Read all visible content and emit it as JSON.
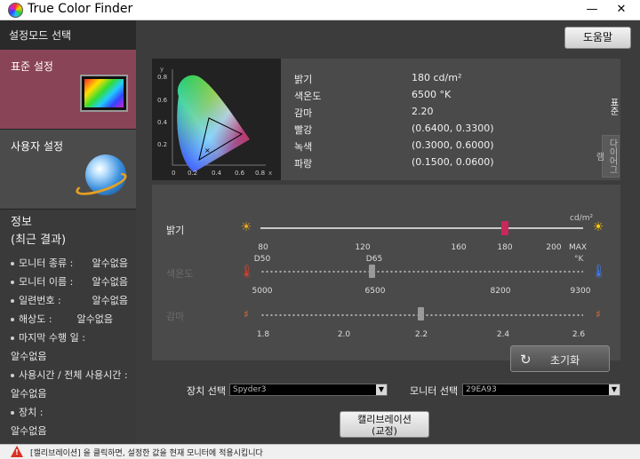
{
  "window": {
    "title": "True Color Finder",
    "minimize": "—",
    "close": "✕"
  },
  "sidebar": {
    "header": "설정모드 선택",
    "modes": [
      {
        "label": "표준 설정"
      },
      {
        "label": "사용자 설정"
      }
    ],
    "info_title_line1": "정보",
    "info_title_line2": "(최근 결과)",
    "info_items": [
      {
        "label": "모니터 종류 :",
        "value": "알수없음"
      },
      {
        "label": "모니터 이름 :",
        "value": "알수없음"
      },
      {
        "label": "일련번호 :",
        "value": "알수없음"
      },
      {
        "label": "해상도 :",
        "value": "알수없음"
      },
      {
        "label": "마지막 수행 일 :",
        "value": "알수없음"
      },
      {
        "label": "사용시간 / 전체 사용시간 :",
        "value": "알수없음"
      },
      {
        "label": "장치 :",
        "value": "알수없음"
      }
    ]
  },
  "help_button": "도움말",
  "gamut": {
    "y_ticks": [
      "0.8",
      "0.6",
      "0.4",
      "0.2"
    ],
    "x_ticks": [
      "0",
      "0.2",
      "0.4",
      "0.6",
      "0.8"
    ],
    "y_axis": "y",
    "x_axis": "x"
  },
  "stats": [
    {
      "key": "밝기",
      "value": "180 cd/m²"
    },
    {
      "key": "색온도",
      "value": "6500 °K"
    },
    {
      "key": "감마",
      "value": "2.20"
    },
    {
      "key": "빨강",
      "value": "(0.6400, 0.3300)"
    },
    {
      "key": "녹색",
      "value": "(0.3000, 0.6000)"
    },
    {
      "key": "파랑",
      "value": "(0.1500, 0.0600)"
    }
  ],
  "side_tabs": {
    "a": "표준",
    "b": "다이어그램"
  },
  "sliders": {
    "brightness": {
      "label": "밝기",
      "unit": "cd/m²",
      "ticks": [
        "80",
        "120",
        "160",
        "180",
        "200",
        "MAX"
      ],
      "value": 180
    },
    "color_temp": {
      "label": "색온도",
      "unit": "°K",
      "presets": [
        "D50",
        "D65"
      ],
      "ticks": [
        "5000",
        "6500",
        "8200",
        "9300"
      ],
      "value": 6500
    },
    "gamma": {
      "label": "감마",
      "ticks": [
        "1.8",
        "2.0",
        "2.2",
        "2.4",
        "2.6"
      ],
      "value": 2.2
    }
  },
  "reset_button": "초기화",
  "device_select": {
    "label": "장치 선택",
    "value": "Spyder3"
  },
  "monitor_select": {
    "label": "모니터 선택",
    "value": "29EA93"
  },
  "calibrate_button": {
    "line1": "캘리브레이션",
    "line2": "(교정)"
  },
  "status": {
    "text": "[캘리브레이션] 을 클릭하면, 설정한 값을 현재 모니터에 적용시킵니다"
  },
  "colors": {
    "accent_pink": "#8a4457",
    "slider_handle_red": "#c8285a",
    "panel": "#4a4a4a"
  }
}
